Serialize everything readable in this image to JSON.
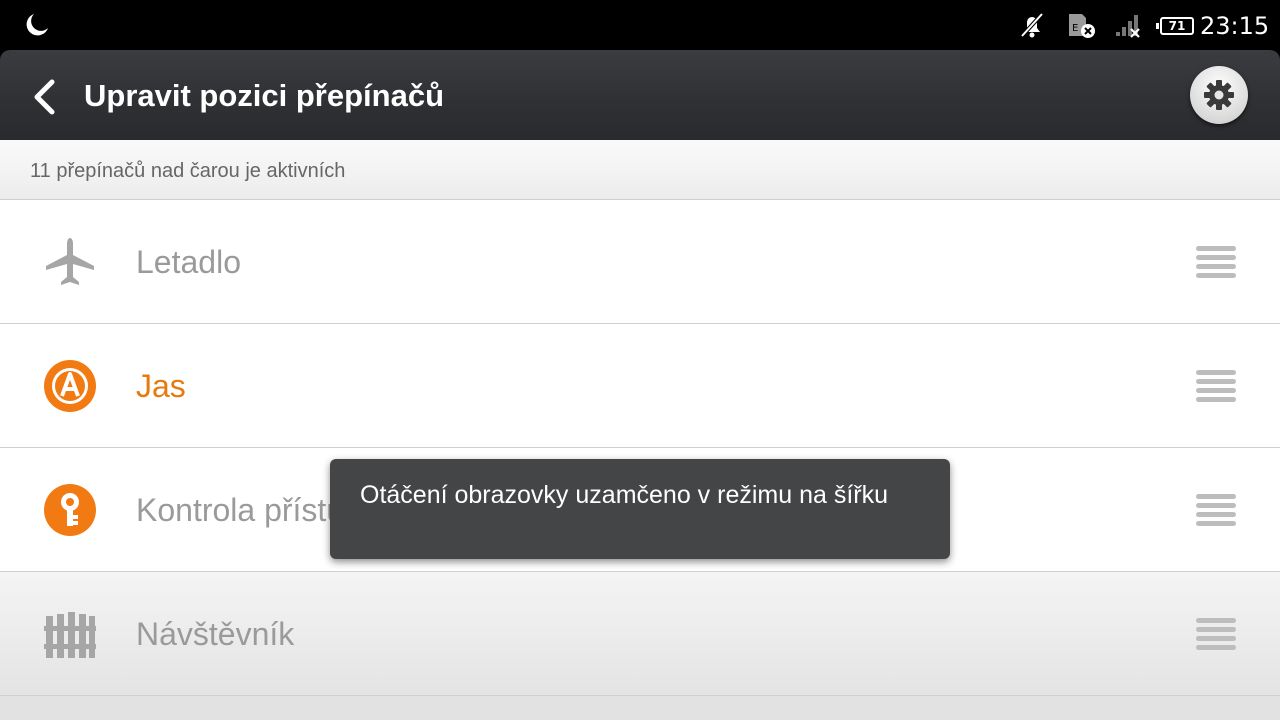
{
  "status_bar": {
    "icons": [
      "moon-icon",
      "notifications-off-icon",
      "sim-error-icon",
      "signal-none-icon"
    ],
    "battery": "71",
    "time": "23:15"
  },
  "header": {
    "title": "Upravit pozici přepínačů",
    "back_icon": "chevron-left-icon",
    "settings_icon": "gear-icon"
  },
  "info": {
    "text": "11 přepínačů nad čarou je aktivních"
  },
  "toggles": [
    {
      "label": "Letadlo",
      "icon": "airplane-icon",
      "active": false
    },
    {
      "label": "Jas",
      "icon": "auto-brightness-icon",
      "active": true
    },
    {
      "label": "Kontrola přístupu",
      "icon": "key-icon",
      "active": false
    },
    {
      "label": "Návštěvník",
      "icon": "fence-icon",
      "active": false
    }
  ],
  "toast": {
    "text": "Otáčení obrazovky uzamčeno v režimu na šířku"
  },
  "colors": {
    "accent": "#e8790d",
    "header_bg": "#2f3033",
    "inactive_text": "#9a9a9a"
  }
}
